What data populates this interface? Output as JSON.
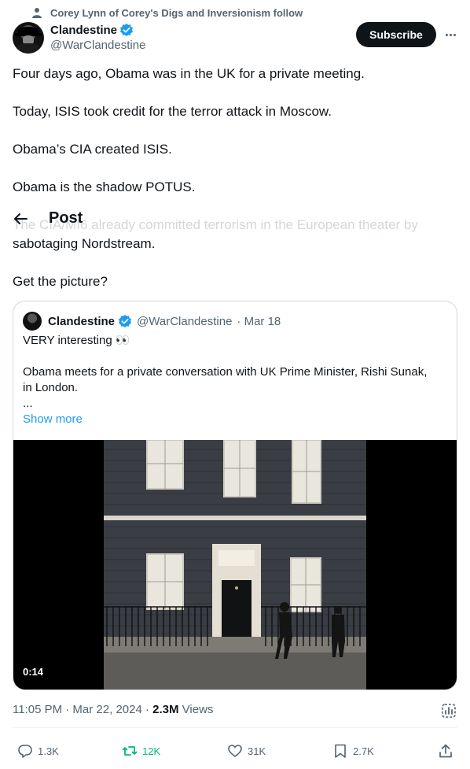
{
  "social_context": "Corey Lynn of Corey's Digs and Inversionism follow",
  "author": {
    "name": "Clandestine",
    "handle": "@WarClandestine"
  },
  "subscribe_label": "Subscribe",
  "tweet_lines": [
    "Four days ago, Obama was in the UK for a private meeting.",
    "Today, ISIS took credit for the terror attack in Moscow.",
    "Obama’s CIA created ISIS.",
    "Obama is the shadow POTUS.",
    "The CIA/MI6 already committed terrorism in the European theater by",
    "sabotaging Nordstream.",
    "Get the picture?"
  ],
  "post_header": {
    "title": "Post"
  },
  "quoted": {
    "name": "Clandestine",
    "handle": "@WarClandestine",
    "date": "· Mar 18",
    "line1": "VERY interesting 👀",
    "line2": "Obama meets for a private conversation with UK Prime Minister, Rishi Sunak,",
    "line3": "in London.",
    "line4": "...",
    "show_more": "Show more",
    "video_duration": "0:14"
  },
  "meta": {
    "timestamp": "11:05 PM · Mar 22, 2024 · ",
    "views_count": "2.3M",
    "views_label": " Views"
  },
  "actions": {
    "replies": "1.3K",
    "reposts": "12K",
    "likes": "31K",
    "bookmarks": "2.7K"
  },
  "colors": {
    "accent": "#1d9bf0",
    "repost_green": "#00ba7c",
    "secondary_text": "#536471"
  },
  "icons": [
    "person-icon",
    "verified-badge-icon",
    "more-icon",
    "back-arrow-icon",
    "analytics-icon",
    "reply-icon",
    "repost-icon",
    "like-icon",
    "bookmark-icon",
    "share-icon"
  ]
}
